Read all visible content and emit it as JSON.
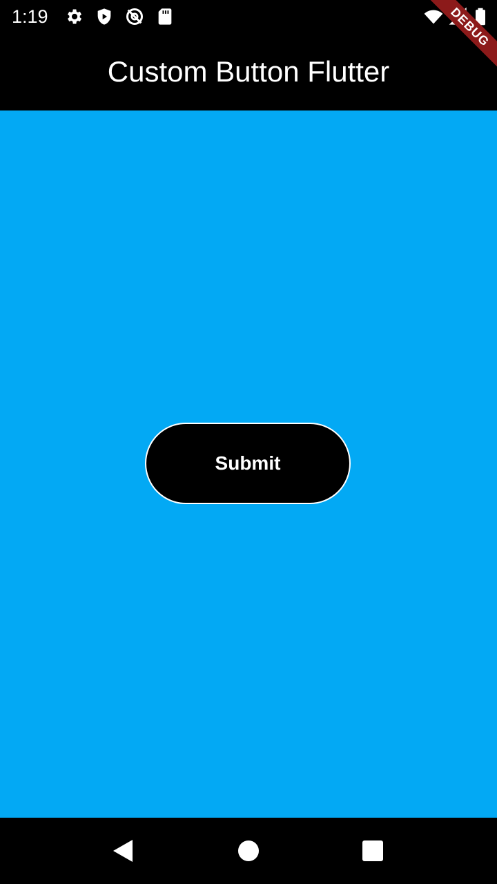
{
  "status_bar": {
    "time": "1:19",
    "icons": [
      "gear-icon",
      "play-protect-icon",
      "no-location-icon",
      "sd-card-icon",
      "wifi-icon",
      "signal-icon",
      "battery-icon"
    ]
  },
  "debug_banner": {
    "label": "DEBUG",
    "color": "#8c1a1a"
  },
  "app_bar": {
    "title": "Custom Button Flutter",
    "background": "#000000"
  },
  "body": {
    "background": "#03a9f4"
  },
  "button": {
    "label": "Submit",
    "background": "#000000",
    "border": "#ffffff"
  },
  "nav_bar": {
    "buttons": [
      "back-icon",
      "home-icon",
      "recents-icon"
    ]
  }
}
